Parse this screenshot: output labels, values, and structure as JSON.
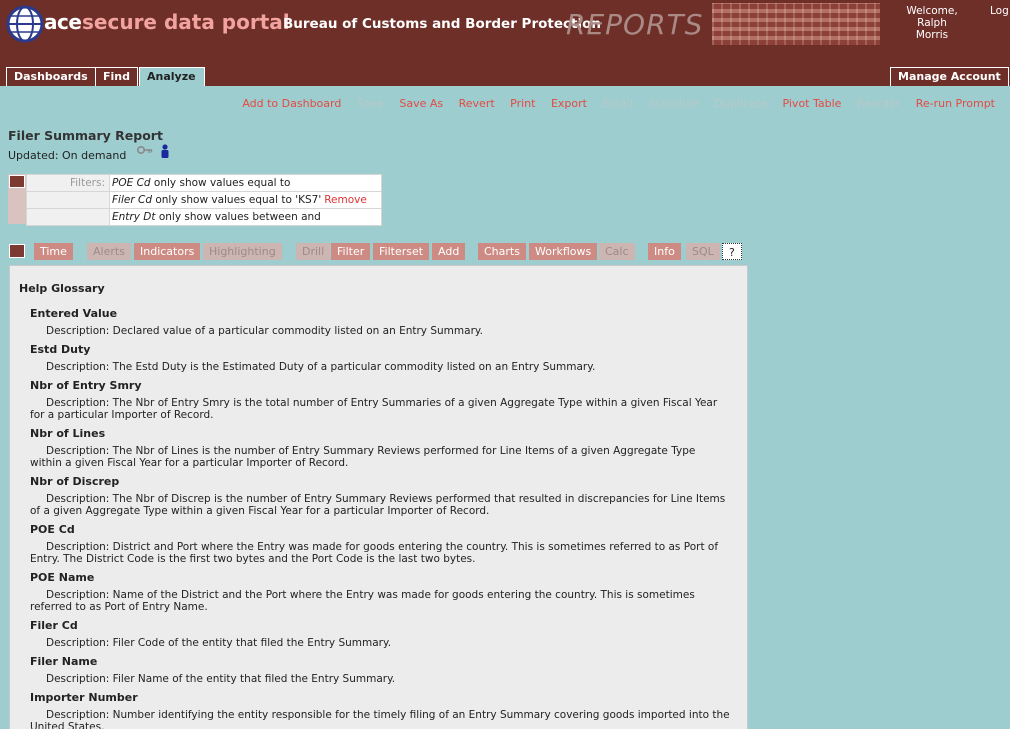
{
  "banner": {
    "logo_ace": "ace",
    "portal_title": "secure data portal",
    "bureau": "Bureau of Customs and Border Protection",
    "reports_label": "REPORTS",
    "welcome": "Welcome,",
    "user_first": "Ralph",
    "user_last": "Morris",
    "logout": "Log"
  },
  "tabs": {
    "dashboards": "Dashboards",
    "find": "Find",
    "analyze": "Analyze",
    "manage_account": "Manage Account"
  },
  "actions": {
    "add_to_dashboard": "Add to Dashboard",
    "save": "Save",
    "save_as": "Save As",
    "revert": "Revert",
    "print": "Print",
    "export": "Export",
    "email": "Email",
    "schedule": "Schedule",
    "duplicate": "Duplicate",
    "pivot_table": "Pivot Table",
    "reorder": "Reorder",
    "rerun_prompt": "Re-run Prompt"
  },
  "report": {
    "title": "Filer Summary Report",
    "updated": "Updated: On demand"
  },
  "filters": {
    "label": "Filters:",
    "rows": [
      {
        "field": "POE Cd",
        "condition": "only show values equal to",
        "value": "",
        "remove": ""
      },
      {
        "field": "Filer Cd",
        "condition": "only show values equal to",
        "value": "'KS7'",
        "remove": "Remove"
      },
      {
        "field": "Entry Dt",
        "condition": "only show values between and",
        "value": "",
        "remove": ""
      }
    ]
  },
  "toolbar": {
    "time": "Time",
    "alerts": "Alerts",
    "indicators": "Indicators",
    "highlighting": "Highlighting",
    "drill": "Drill",
    "filter": "Filter",
    "filterset": "Filterset",
    "add": "Add",
    "charts": "Charts",
    "workflows": "Workflows",
    "calc": "Calc",
    "info": "Info",
    "sql": "SQL",
    "help": "?"
  },
  "glossary": {
    "title": "Help Glossary",
    "terms": [
      {
        "name": "Entered Value",
        "description": "Description: Declared value of a particular commodity listed on an Entry Summary."
      },
      {
        "name": "Estd Duty",
        "description": "Description: The Estd Duty is the Estimated Duty of a particular commodity listed on an Entry Summary."
      },
      {
        "name": "Nbr of Entry Smry",
        "description": "Description: The Nbr of Entry Smry is the total number of Entry Summaries of a given Aggregate Type within a given Fiscal Year for a particular Importer of Record."
      },
      {
        "name": "Nbr of Lines",
        "description": "Description: The Nbr of Lines is the number of Entry Summary Reviews performed for Line Items of a given Aggregate Type within a given Fiscal Year for a particular Importer of Record."
      },
      {
        "name": "Nbr of Discrep",
        "description": "Description: The Nbr of Discrep is the number of Entry Summary Reviews performed that resulted in discrepancies for Line Items of a given Aggregate Type within a given Fiscal Year for a particular Importer of Record."
      },
      {
        "name": "POE Cd",
        "description": "Description: District and Port where the Entry was made for goods entering the country. This is sometimes referred to as Port of Entry. The District Code is the first two bytes and the Port Code is the last two bytes."
      },
      {
        "name": "POE Name",
        "description": "Description: Name of the District and the Port where the Entry was made for goods entering the country. This is sometimes referred to as Port of Entry Name."
      },
      {
        "name": "Filer Cd",
        "description": "Description: Filer Code of the entity that filed the Entry Summary."
      },
      {
        "name": "Filer Name",
        "description": "Description: Filer Name of the entity that filed the Entry Summary."
      },
      {
        "name": "Importer Number",
        "description": "Description: Number identifying the entity responsible for the timely filing of an Entry Summary covering goods imported into the United States."
      }
    ]
  },
  "colors": {
    "banner": "#6e2f29",
    "page_background": "#9dcdcf",
    "action_link": "#e24b43",
    "toolbar_button": "#cd8b84",
    "panel": "#ececec"
  }
}
